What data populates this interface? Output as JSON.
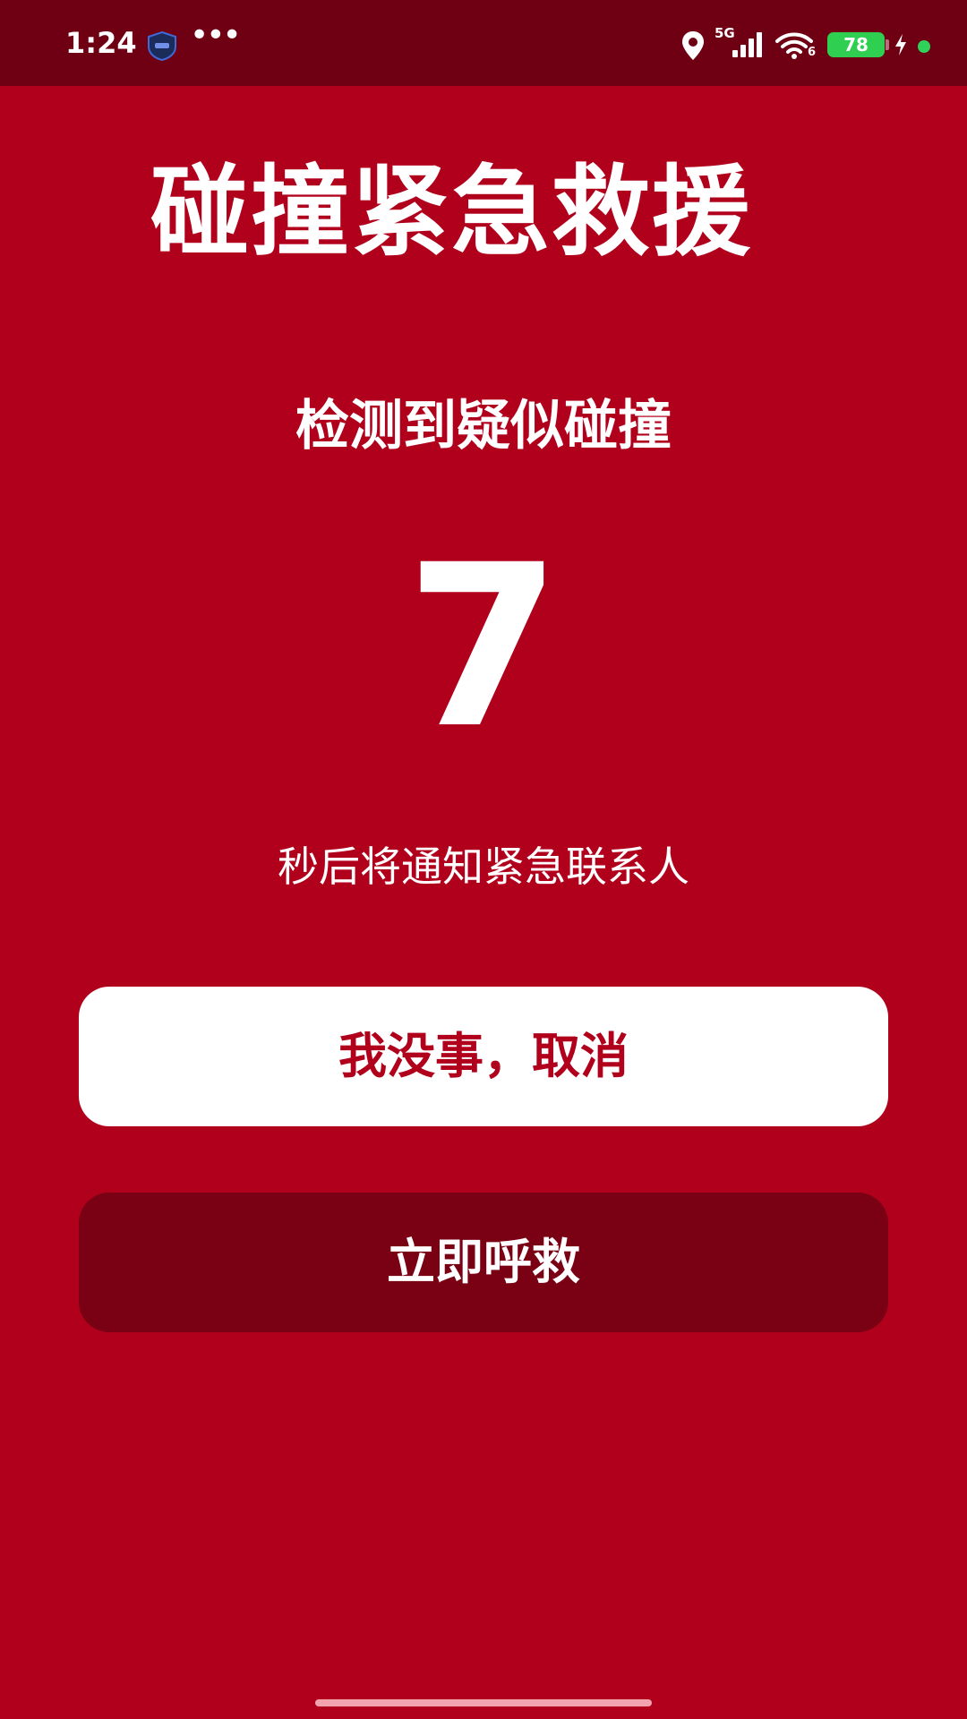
{
  "status_bar": {
    "time": "1:24",
    "more_indicator": "•••",
    "network_label": "5G",
    "wifi_sub_label": "6",
    "battery_level": "78",
    "icons": [
      "shield-app-icon",
      "location-icon",
      "signal-icon",
      "wifi-icon",
      "charging-icon"
    ]
  },
  "screen": {
    "title": "碰撞紧急救援",
    "alert_heading": "检测到疑似碰撞",
    "countdown": "7",
    "countdown_message": "秒后将通知紧急联系人"
  },
  "actions": {
    "cancel_label": "我没事，取消",
    "call_label": "立即呼救"
  },
  "colors": {
    "background": "#b1001c",
    "status_bar": "#6f0014",
    "cancel_button_bg": "#ffffff",
    "cancel_button_text": "#b1001c",
    "call_button_bg": "#7a0014",
    "battery": "#2fcf51"
  }
}
